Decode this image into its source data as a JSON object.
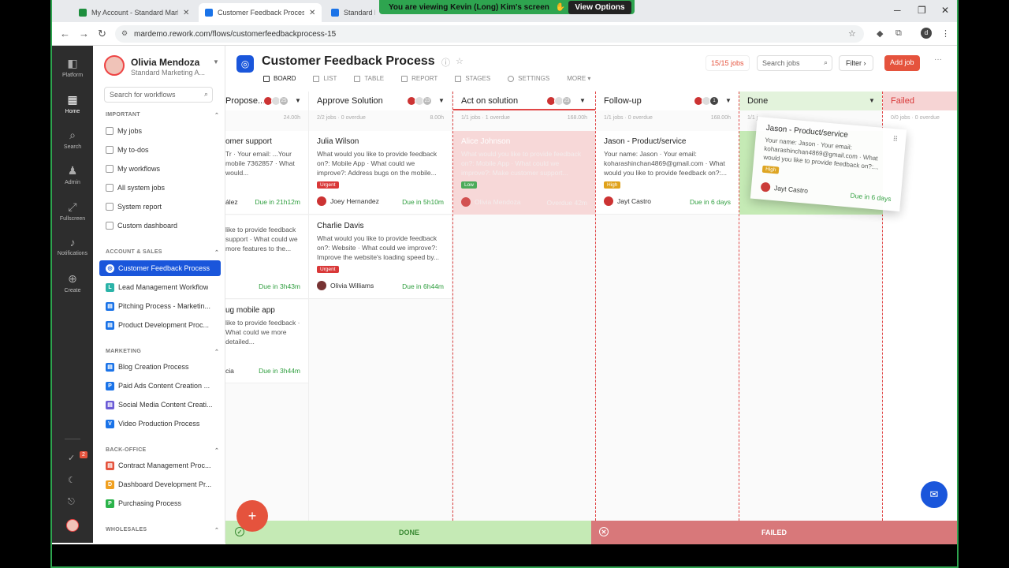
{
  "browser": {
    "tabs": [
      {
        "title": "My Account - Standard Marketi",
        "color": "#1e8e3e"
      },
      {
        "title": "Customer Feedback Process - V",
        "color": "#1a73e8"
      },
      {
        "title": "Standard M",
        "color": "#1a73e8"
      }
    ],
    "url": "mardemo.rework.com/flows/customerfeedbackprocess-15",
    "profile_initial": "d"
  },
  "share_banner": {
    "text": "You are viewing  Kevin (Long) Kim's screen",
    "options": "View Options"
  },
  "rail": [
    {
      "label": "Platform",
      "icon": "platform-icon"
    },
    {
      "label": "Home",
      "icon": "home-icon"
    },
    {
      "label": "Search",
      "icon": "search-icon"
    },
    {
      "label": "Admin",
      "icon": "admin-icon"
    },
    {
      "label": "Fullscreen",
      "icon": "fullscreen-icon"
    },
    {
      "label": "Notifications",
      "icon": "bell-icon"
    },
    {
      "label": "Create",
      "icon": "plus-icon"
    }
  ],
  "rail_badge": "2",
  "user": {
    "name": "Olivia Mendoza",
    "team": "Standard Marketing A..."
  },
  "sidebar": {
    "search_placeholder": "Search for workflows",
    "important_title": "IMPORTANT",
    "important": [
      "My jobs",
      "My to-dos",
      "My workflows",
      "All system jobs",
      "System report",
      "Custom dashboard"
    ],
    "account_title": "ACCOUNT & SALES",
    "account": [
      {
        "label": "Customer Feedback Process",
        "color": "#1a56db",
        "letter": ""
      },
      {
        "label": "Lead Management Workflow",
        "color": "#2bb3a8",
        "letter": "L"
      },
      {
        "label": "Pitching Process - Marketin...",
        "color": "#1a73e8",
        "letter": ""
      },
      {
        "label": "Product Development Proc...",
        "color": "#1a73e8",
        "letter": ""
      }
    ],
    "marketing_title": "MARKETING",
    "marketing": [
      {
        "label": "Blog Creation Process",
        "color": "#1a73e8",
        "letter": ""
      },
      {
        "label": "Paid Ads Content Creation ...",
        "color": "#1a73e8",
        "letter": "P"
      },
      {
        "label": "Social Media Content Creati...",
        "color": "#6b5bd6",
        "letter": ""
      },
      {
        "label": "Video Production Process",
        "color": "#1a73e8",
        "letter": "V"
      }
    ],
    "backoffice_title": "BACK-OFFICE",
    "backoffice": [
      {
        "label": "Contract Management Proc...",
        "color": "#e5533d",
        "letter": ""
      },
      {
        "label": "Dashboard Development Pr...",
        "color": "#f0a020",
        "letter": "D"
      },
      {
        "label": "Purchasing Process",
        "color": "#2bb34a",
        "letter": "P"
      }
    ],
    "wholesales_title": "WHOLESALES"
  },
  "header": {
    "title": "Customer Feedback Process",
    "job_count": "15/15 jobs",
    "search_placeholder": "Search jobs",
    "filter": "Filter",
    "add_job": "Add job",
    "views": [
      "BOARD",
      "LIST",
      "TABLE",
      "REPORT",
      "STAGES",
      "SETTINGS",
      "MORE"
    ]
  },
  "columns": [
    {
      "name": "Propose...",
      "meta_left": "",
      "meta_right": "24.00h",
      "count": "25"
    },
    {
      "name": "Approve Solution",
      "meta_left": "2/2 jobs · 0 overdue",
      "meta_right": "8.00h",
      "count": "23"
    },
    {
      "name": "Act on solution",
      "meta_left": "1/1 jobs · 1 overdue",
      "meta_right": "168.00h",
      "count": "23"
    },
    {
      "name": "Follow-up",
      "meta_left": "1/1 jobs · 0 overdue",
      "meta_right": "168.00h",
      "count": "1"
    },
    {
      "name": "Done",
      "meta_left": "1/1 j",
      "meta_right": "",
      "count": ""
    },
    {
      "name": "Failed",
      "meta_left": "0/0 jobs · 0 overdue",
      "meta_right": "",
      "count": ""
    }
  ],
  "cards": {
    "c0a": {
      "name": "omer support",
      "desc": "Tr · Your email: ...Your mobile 7362857 · What would...",
      "assignee": "ález",
      "due": "Due in 21h12m"
    },
    "c0b": {
      "name": "",
      "desc": "like to provide feedback support · What could we more features to the...",
      "assignee": "",
      "due": "Due in 3h43m"
    },
    "c0c": {
      "name": "ug mobile app",
      "desc": "like to provide feedback · What could we more detailed...",
      "assignee": "cia",
      "due": "Due in 3h44m"
    },
    "c1a": {
      "name": "Julia Wilson",
      "desc": "What would you like to provide feedback on?: Mobile App · What could we improve?: Address bugs on the mobile...",
      "tag": "Urgent",
      "assignee": "Joey Hernandez",
      "due": "Due in 5h10m"
    },
    "c1b": {
      "name": "Charlie Davis",
      "desc": "What would you like to provide feedback on?: Website · What could we improve?: Improve the website's loading speed by...",
      "tag": "Urgent",
      "assignee": "Olivia Williams",
      "due": "Due in 6h44m"
    },
    "c2a": {
      "name": "Alice Johnson",
      "desc": "What would you like to provide feedback on?: Mobile App · What could we improve?: Make customer support...",
      "tag": "Low",
      "assignee": "Olivia Mendoza",
      "due": "Overdue 42m"
    },
    "c3a": {
      "name": "Jason - Product/service",
      "desc": "Your name: Jason · Your email: koharashinchan4869@gmail.com · What would you like to provide feedback on?:...",
      "tag": "High",
      "assignee": "Jayt Castro",
      "due": "Due in 6 days"
    },
    "drag": {
      "name": "Jason - Product/service",
      "desc": "Your name: Jason · Your email: koharashinchan4869@gmail.com · What would you like to provide feedback on?:...",
      "tag": "High",
      "assignee": "Jayt Castro",
      "due": "Due in 6 days"
    }
  },
  "zones": {
    "done": "DONE",
    "failed": "FAILED"
  },
  "colors": {
    "accent": "#1a56db",
    "primary_action": "#e5533d",
    "done_zone": "#c5eab5",
    "failed_zone": "#d8787a",
    "share_green": "#2ea44f"
  }
}
